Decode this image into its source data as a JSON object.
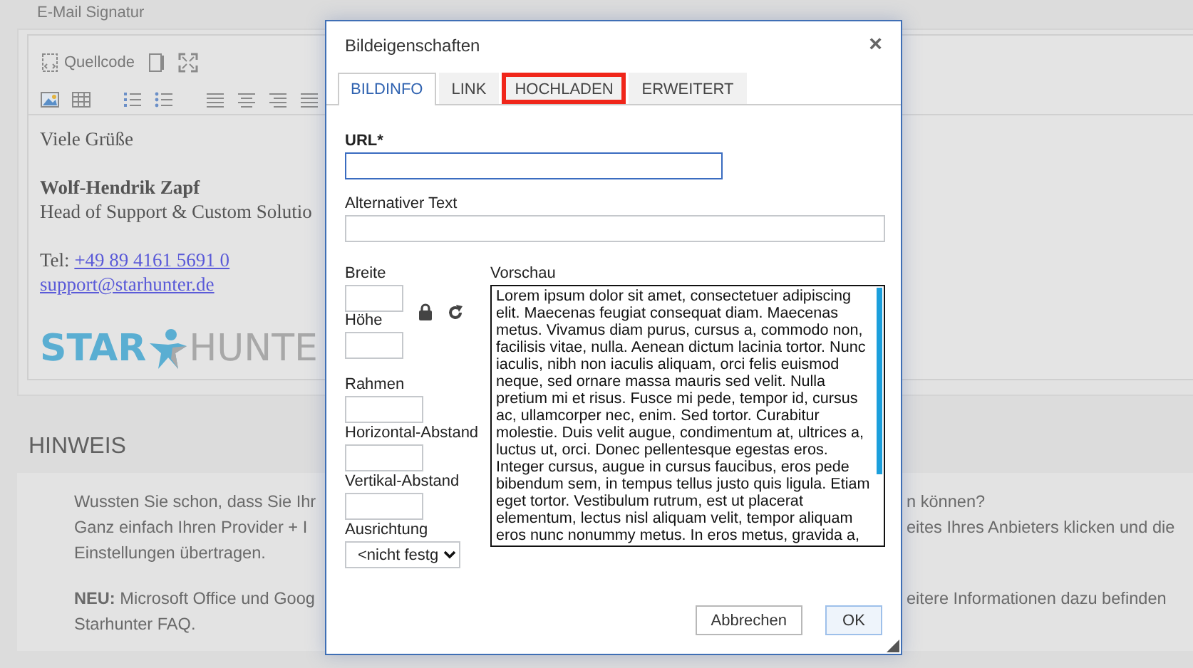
{
  "signature_section": {
    "label": "E-Mail Signatur",
    "toolbar": {
      "source_button": "Quellcode"
    },
    "signature": {
      "greeting": "Viele Grüße",
      "name": "Wolf-Hendrik Zapf",
      "position": "Head of Support & Custom Solutio",
      "phone_label": "Tel:",
      "phone": "+49 89 4161 5691 0",
      "email": "support@starhunter.de",
      "logo": {
        "first": "STAR",
        "second": "HUNTE"
      }
    }
  },
  "notice": {
    "title": "HINWEIS",
    "paragraphs": [
      [
        {
          "left": "Wussten Sie schon, dass Sie Ihr",
          "right": "n können?"
        },
        {
          "left": "Ganz einfach Ihren Provider + I",
          "right": "eites Ihres Anbieters klicken und die"
        },
        {
          "left": "Einstellungen übertragen."
        }
      ],
      [
        {
          "left": "**NEU:** Microsoft Office und Goog",
          "right": "eitere Informationen dazu befinden"
        },
        {
          "left": "Starhunter FAQ."
        }
      ]
    ]
  },
  "dialog": {
    "title": "Bildeigenschaften",
    "close": "×",
    "tabs": [
      {
        "label": "BILDINFO",
        "selected": true,
        "highlighted": false
      },
      {
        "label": "LINK",
        "selected": false,
        "highlighted": false
      },
      {
        "label": "HOCHLADEN",
        "selected": false,
        "highlighted": true
      },
      {
        "label": "ERWEITERT",
        "selected": false,
        "highlighted": false
      }
    ],
    "url": {
      "label": "URL*",
      "focused": true
    },
    "alt_text": {
      "label": "Alternativer Text",
      "focused": false
    },
    "size_fields": [
      {
        "label": "Breite"
      },
      {
        "label": "Höhe"
      }
    ],
    "spacing_fields": [
      {
        "label": "Rahmen"
      },
      {
        "label": "Horizontal-Abstand"
      },
      {
        "label": "Vertikal-Abstand"
      }
    ],
    "alignment": {
      "label": "Ausrichtung",
      "value": "<nicht festg"
    },
    "preview": {
      "label": "Vorschau",
      "text": "Lorem ipsum dolor sit amet, consectetuer adipiscing elit. Maecenas feugiat consequat diam. Maecenas metus. Vivamus diam purus, cursus a, commodo non, facilisis vitae, nulla. Aenean dictum lacinia tortor. Nunc iaculis, nibh non iaculis aliquam, orci felis euismod neque, sed ornare massa mauris sed velit. Nulla pretium mi et risus. Fusce mi pede, tempor id, cursus ac, ullamcorper nec, enim. Sed tortor. Curabitur molestie. Duis velit augue, condimentum at, ultrices a, luctus ut, orci. Donec pellentesque egestas eros. Integer cursus, augue in cursus faucibus, eros pede bibendum sem, in tempus tellus justo quis ligula. Etiam eget tortor. Vestibulum rutrum, est ut placerat elementum, lectus nisl aliquam velit, tempor aliquam eros nunc nonummy metus. In eros metus, gravida a,"
    },
    "buttons": [
      {
        "label": "Abbrechen",
        "kind": "cancel"
      },
      {
        "label": "OK",
        "kind": "default"
      }
    ]
  }
}
